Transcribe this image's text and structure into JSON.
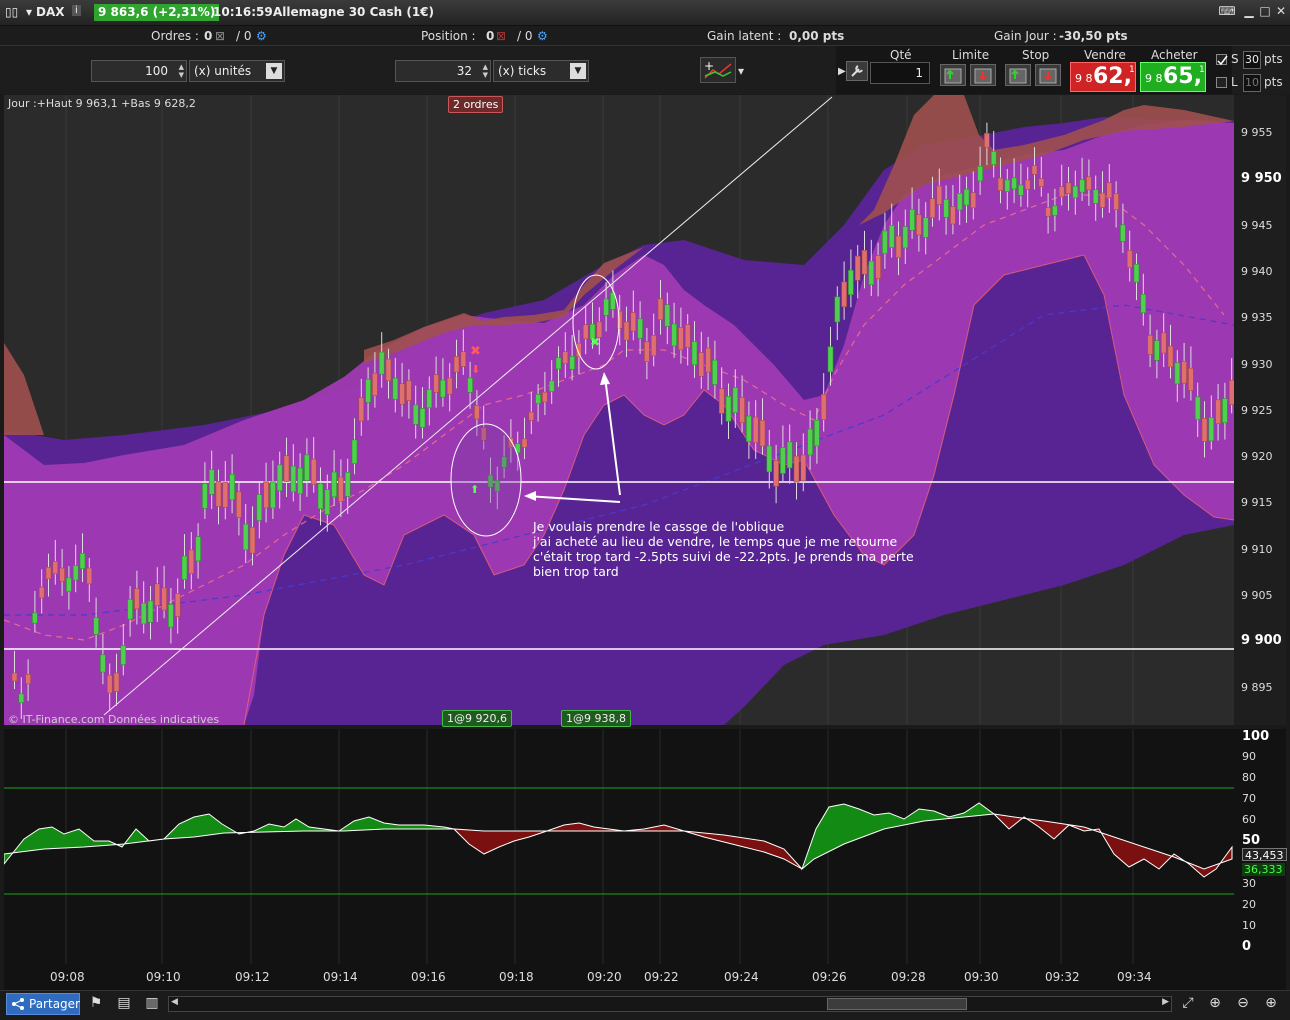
{
  "titlebar": {
    "symbol": "DAX",
    "info_icon": "i",
    "price_badge": "9 863,6 (+2,31%)",
    "time": "10:16:59",
    "instrument": "Allemagne 30 Cash (1€)"
  },
  "status": {
    "orders_label": "Ordres :",
    "orders_value": "0",
    "orders_total": "/ 0",
    "position_label": "Position :",
    "position_value": "0",
    "position_total": "/ 0",
    "gain_latent_label": "Gain latent :",
    "gain_latent_value": "0,00 pts",
    "gain_jour_label": "Gain Jour :",
    "gain_jour_value": "-30,50 pts"
  },
  "toolbar": {
    "qty_spin_value": "100",
    "qty_unit": "(x) unités",
    "ticks_spin_value": "32",
    "ticks_unit": "(x) ticks",
    "qte_label": "Qté",
    "qte_value": "1",
    "limite_label": "Limite",
    "stop_label": "Stop",
    "vendre_label": "Vendre",
    "acheter_label": "Acheter",
    "sell_small": "9 8",
    "sell_big": "62,",
    "sell_sup": "1",
    "buy_small": "9 8",
    "buy_big": "65,",
    "buy_sup": "1",
    "s_label": "S",
    "s_pts": "30",
    "l_label": "L",
    "l_pts": "10",
    "pts_label": "pts"
  },
  "chart": {
    "day_info": "Jour :+Haut 9 963,1 +Bas 9 628,2",
    "orders_badge": "2 ordres",
    "copyright": "© IT-Finance.com Données indicatives",
    "fill_badge_1": "1@9 920,6",
    "fill_badge_2": "1@9 938,8",
    "annotation": "Je voulais prendre le cassge de l'oblique\nj'ai acheté au lieu de vendre, le temps que je me retourne\nc'était trop tard -2.5pts suivi de -22.2pts. Je prends ma perte\nbien trop tard",
    "price_labels": [
      "9 955",
      "9 950",
      "9 945",
      "9 940",
      "9 935",
      "9 930",
      "9 925",
      "9 920",
      "9 915",
      "9 910",
      "9 905",
      "9 900",
      "9 895"
    ],
    "indicator_labels": [
      "100",
      "90",
      "80",
      "70",
      "60",
      "50",
      "40",
      "30",
      "20",
      "10",
      "0"
    ],
    "indicator_value_1": "43,453",
    "indicator_value_2": "36,333",
    "time_labels": [
      "09:08",
      "09:10",
      "09:12",
      "09:14",
      "09:16",
      "09:18",
      "09:20",
      "09:22",
      "09:24",
      "09:26",
      "09:28",
      "09:30",
      "09:32",
      "09:34"
    ],
    "colors": {
      "up": "#4fd14f",
      "down": "#e07070",
      "band_purple": "#6a2aa8",
      "band_magenta": "#a03cb0",
      "band_red": "#a05050"
    }
  },
  "bottombar": {
    "share_label": "Partager"
  }
}
